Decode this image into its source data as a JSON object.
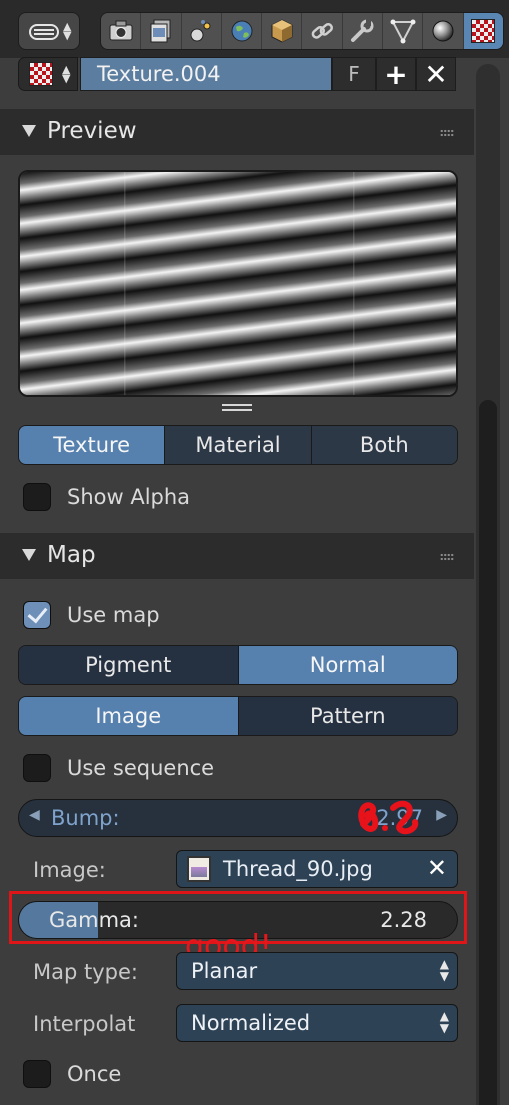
{
  "toolbar": {
    "tabs": [
      {
        "icon": "render-icon"
      },
      {
        "icon": "render-layers-icon"
      },
      {
        "icon": "scene-icon"
      },
      {
        "icon": "world-icon"
      },
      {
        "icon": "object-icon"
      },
      {
        "icon": "constraints-icon"
      },
      {
        "icon": "modifiers-icon"
      },
      {
        "icon": "data-icon"
      },
      {
        "icon": "material-icon"
      },
      {
        "icon": "texture-icon",
        "active": true
      }
    ]
  },
  "texture_block": {
    "name": "Texture.004",
    "fake_user_label": "F",
    "add_label": "+",
    "remove_label": "✕"
  },
  "preview": {
    "title": "Preview",
    "modes": [
      "Texture",
      "Material",
      "Both"
    ],
    "active_mode": "Texture",
    "show_alpha_label": "Show Alpha",
    "show_alpha": false
  },
  "map": {
    "title": "Map",
    "use_map_label": "Use map",
    "use_map": true,
    "type_options": [
      "Pigment",
      "Normal"
    ],
    "active_type": "Normal",
    "source_options": [
      "Image",
      "Pattern"
    ],
    "active_source": "Image",
    "use_sequence_label": "Use sequence",
    "use_sequence": false,
    "bump_label": "Bump:",
    "bump_value": "2.97",
    "image_label": "Image:",
    "image_name": "Thread_90.jpg",
    "gamma_label": "Gamma:",
    "gamma_value": "2.28",
    "gamma_fill": 0.18,
    "map_type_label": "Map type:",
    "map_type_value": "Planar",
    "interpolation_label": "Interpolat",
    "interpolation_value": "Normalized",
    "once_label": "Once",
    "once": false
  },
  "annotation": {
    "text": "good!",
    "color": "#e01518"
  },
  "colors": {
    "accent": "#5680ae",
    "panel_header": "#2c2c2c",
    "background": "#3d3d3d"
  }
}
